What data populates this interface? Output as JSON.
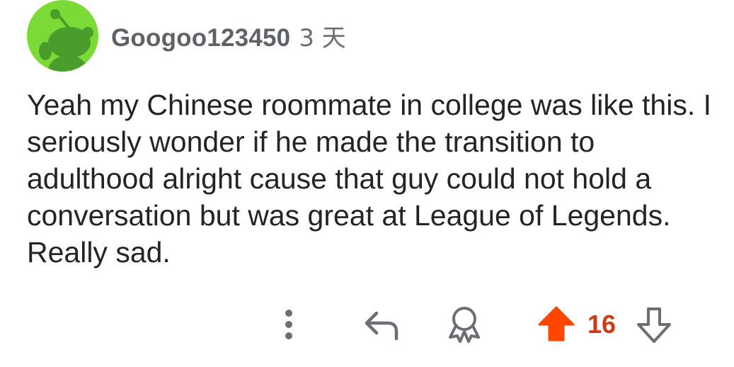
{
  "comment": {
    "author": "Googoo123450",
    "age": "3 天",
    "body": "Yeah my Chinese roommate in college was like this. I seriously wonder if he made the transition to adulthood alright cause that guy could not hold a conversation but was great at League of Legends. Really sad.",
    "score": "16",
    "vote_state": "upvoted"
  },
  "colors": {
    "avatar_bg": "#7cda37",
    "avatar_fg": "#4a9d2a",
    "upvote_active": "#ff4500",
    "score_text": "#cc3b16",
    "icon_gray": "#6b6f73"
  },
  "icons": {
    "more": "more-vertical-icon",
    "reply": "reply-icon",
    "award": "award-icon",
    "upvote": "upvote-arrow-icon",
    "downvote": "downvote-arrow-icon"
  }
}
